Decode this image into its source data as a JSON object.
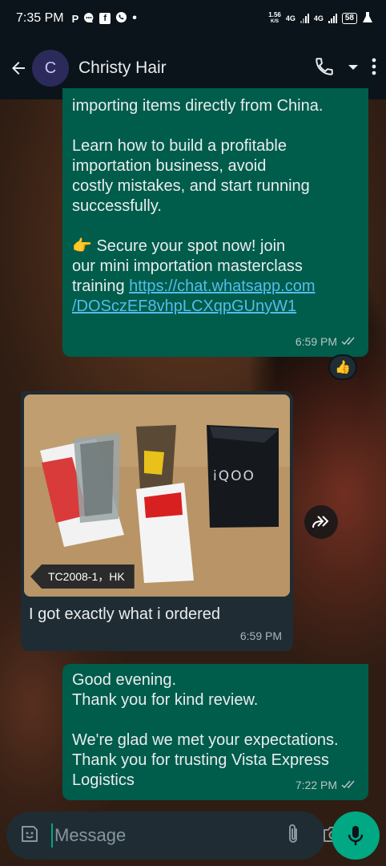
{
  "status": {
    "time": "7:35 PM",
    "notif_icons": [
      "P",
      "P",
      "f",
      "whatsapp",
      "•"
    ],
    "net_speed_value": "1.56",
    "net_speed_unit": "K/S",
    "net1": "4G",
    "net2": "4G",
    "battery": "58"
  },
  "header": {
    "avatar_letter": "C",
    "contact_name": "Christy Hair"
  },
  "messages": [
    {
      "direction": "outgoing",
      "text": "importing items directly from China.\n\nLearn how to build a profitable\nimportation business, avoid\ncostly mistakes, and start running\nsuccessfully.\n\n👉 Secure your spot now! join\nour mini importation masterclass\ntraining ",
      "link": "https://chat.whatsapp.com\n/DOSczEF8vhpLCXqpGUnyW1",
      "time": "6:59 PM",
      "reaction": "👍"
    },
    {
      "direction": "incoming",
      "image_caption_tag": "TC2008-1，HK",
      "image_box_text": "iQOO",
      "text": "I got exactly what i ordered",
      "time": "6:59 PM"
    },
    {
      "direction": "outgoing",
      "text": "Good evening.\nThank you for kind review.\n\nWe're glad we met your expectations.\nThank you for trusting Vista Express\nLogistics",
      "time": "7:22 PM"
    }
  ],
  "composer": {
    "placeholder": "Message"
  },
  "colors": {
    "header_bg": "#0b141a",
    "outgoing_bubble": "#005c4b",
    "incoming_bubble": "#202c33",
    "link": "#53bdeb",
    "accent": "#00a884"
  }
}
